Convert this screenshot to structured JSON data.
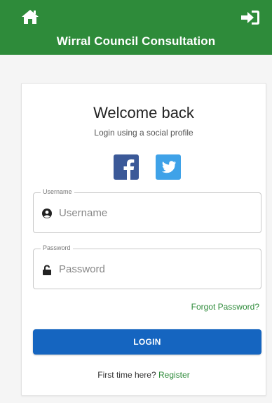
{
  "header": {
    "title": "Wirral Council Consultation",
    "home_icon": "home-icon",
    "login_icon": "sign-in-icon",
    "bg_color": "#2e8b3a"
  },
  "login": {
    "heading": "Welcome back",
    "subheading": "Login using a social profile",
    "social": [
      {
        "name": "facebook",
        "icon": "facebook-icon",
        "color": "#3b5998"
      },
      {
        "name": "twitter",
        "icon": "twitter-icon",
        "color": "#3fa2e8"
      }
    ],
    "username": {
      "label": "Username",
      "placeholder": "Username",
      "icon": "user-icon"
    },
    "password": {
      "label": "Password",
      "placeholder": "Password",
      "icon": "lock-icon"
    },
    "forgot_label": "Forgot Password?",
    "login_label": "LOGIN",
    "first_time_text": "First time here?",
    "register_label": "Register",
    "accent_color": "#1565c0"
  }
}
